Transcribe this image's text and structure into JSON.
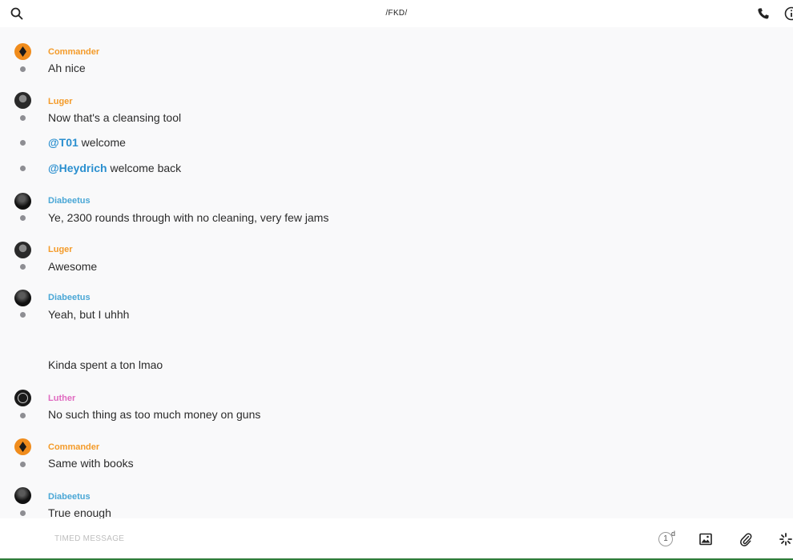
{
  "header": {
    "title": "/FKD/",
    "icons": [
      "search-icon",
      "phone-icon",
      "info-icon"
    ]
  },
  "messages": [
    {
      "author": "Commander",
      "text": "Ah nice"
    },
    {
      "author": "Luger",
      "text": "Now that's a cleansing tool"
    },
    {
      "mention": "@T01",
      "text": " welcome"
    },
    {
      "mention": "@Heydrich",
      "text": " welcome back"
    },
    {
      "author": "Diabeetus",
      "text": "Ye, 2300 rounds through with no cleaning, very few jams"
    },
    {
      "author": "Luger",
      "text": "Awesome"
    },
    {
      "author": "Diabeetus",
      "text": "Yeah, but I uhhh"
    },
    {
      "text": "Kinda spent a ton lmao"
    },
    {
      "author": "Luther",
      "text": "No such thing as too much money on guns"
    },
    {
      "author": "Commander",
      "text": "Same with books"
    },
    {
      "author": "Diabeetus",
      "text": "True enough"
    }
  ],
  "composer": {
    "placeholder": "TIMED MESSAGE",
    "timer_value": "1",
    "timer_unit": "d",
    "icons": [
      "timer-icon",
      "image-icon",
      "attachment-icon",
      "sparkle-icon"
    ]
  },
  "colors": {
    "commander": "#f49b29",
    "luger": "#f49b29",
    "diabeetus": "#4aa7d6",
    "luther": "#e06ac0",
    "mention": "#2a8fcf"
  }
}
